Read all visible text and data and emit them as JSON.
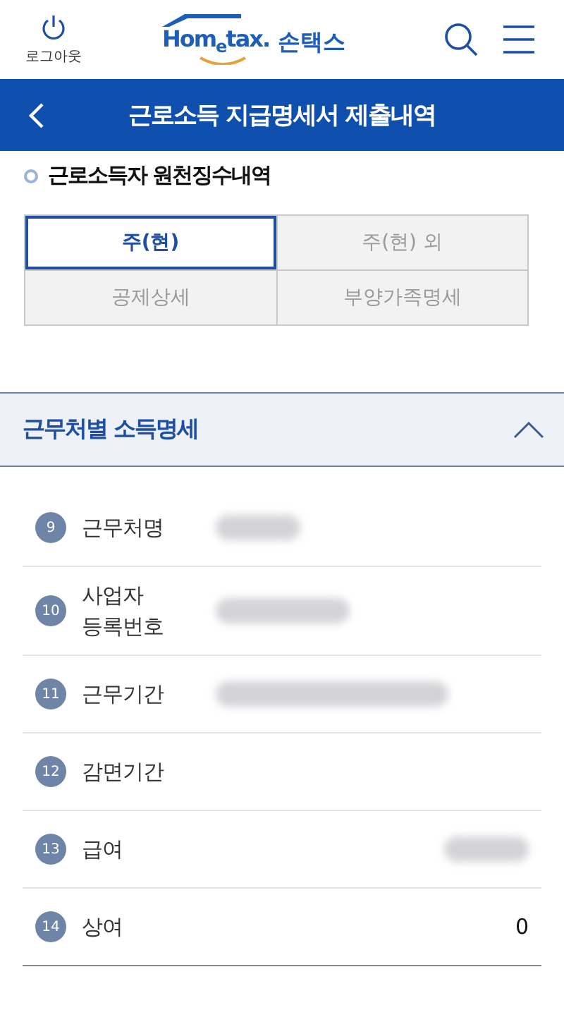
{
  "header": {
    "logout_label": "로그아웃",
    "logo_text": "Hom$_{e}$tax.",
    "logo_brand": "손택스"
  },
  "title_bar": {
    "title": "근로소득 지급명세서 제출내역"
  },
  "section": {
    "title": "근로소득자 원천징수내역"
  },
  "tabs": [
    {
      "label": "주(현)",
      "selected": true
    },
    {
      "label": "주(현) 외",
      "selected": false
    },
    {
      "label": "공제상세",
      "selected": false
    },
    {
      "label": "부양가족명세",
      "selected": false
    }
  ],
  "accordion": {
    "title": "근무처별 소득명세",
    "expanded": true
  },
  "rows": [
    {
      "number": "9",
      "label": "근무처명",
      "kind": "text",
      "redacted": true
    },
    {
      "number": "10",
      "label": "사업자\n등록번호",
      "kind": "text",
      "redacted": true
    },
    {
      "number": "11",
      "label": "근무기간",
      "kind": "text",
      "redacted": true
    },
    {
      "number": "12",
      "label": "감면기간",
      "kind": "text",
      "redacted": false
    },
    {
      "number": "13",
      "label": "급여",
      "kind": "amount",
      "redacted": true
    },
    {
      "number": "14",
      "label": "상여",
      "kind": "amount",
      "redacted": false,
      "value": "0"
    }
  ]
}
